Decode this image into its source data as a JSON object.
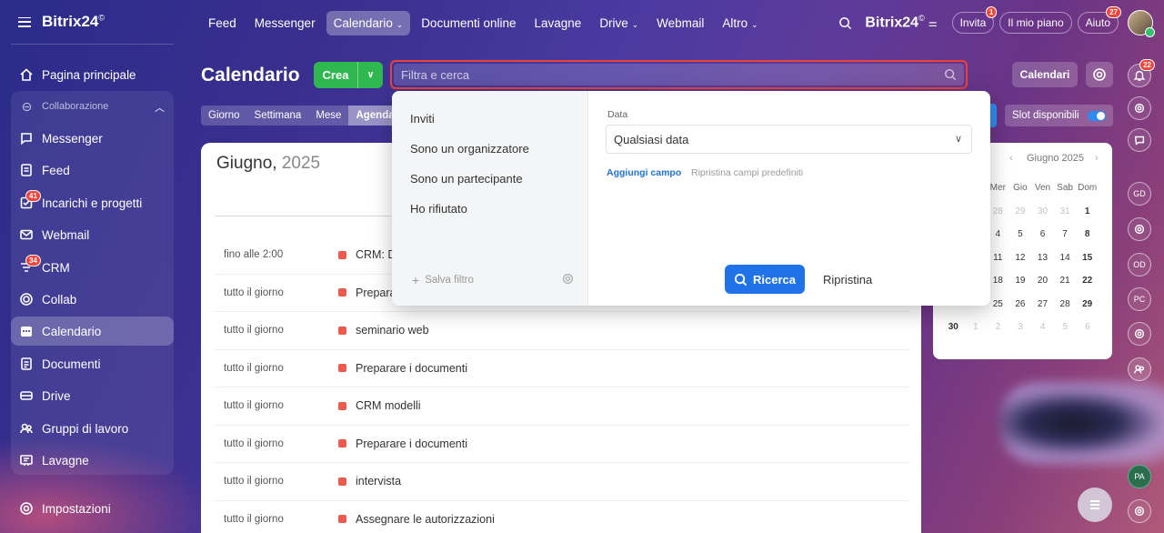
{
  "brand": {
    "name": "Bitrix24",
    "mark": "©"
  },
  "sidebar": {
    "group_label": "Collaborazione",
    "items": [
      {
        "label": "Pagina principale",
        "icon": "home-icon"
      },
      {
        "label": "Messenger",
        "icon": "chat-icon"
      },
      {
        "label": "Feed",
        "icon": "feed-icon"
      },
      {
        "label": "Incarichi e progetti",
        "icon": "tasks-icon",
        "badge": "41"
      },
      {
        "label": "Webmail",
        "icon": "mail-icon"
      },
      {
        "label": "CRM",
        "icon": "crm-icon",
        "badge": "34"
      },
      {
        "label": "Collab",
        "icon": "collab-icon"
      },
      {
        "label": "Calendario",
        "icon": "calendar-icon",
        "active": true
      },
      {
        "label": "Documenti",
        "icon": "document-icon"
      },
      {
        "label": "Drive",
        "icon": "drive-icon"
      },
      {
        "label": "Gruppi di lavoro",
        "icon": "groups-icon"
      },
      {
        "label": "Lavagne",
        "icon": "board-icon"
      }
    ],
    "settings_label": "Impostazioni"
  },
  "topnav": {
    "links": [
      "Feed",
      "Messenger",
      "Calendario",
      "Documenti online",
      "Lavagne",
      "Drive",
      "Webmail",
      "Altro"
    ],
    "invita": "Invita",
    "invita_badge": "1",
    "my_plan": "Il mio piano",
    "help": "Aiuto",
    "help_badge": "27"
  },
  "header": {
    "title": "Calendario",
    "create": "Crea",
    "search_placeholder": "Filtra e cerca",
    "calendars_button": "Calendari",
    "slot_label": "Slot disponibili"
  },
  "view_tabs": [
    "Giorno",
    "Settimana",
    "Mese",
    "Agenda"
  ],
  "agenda": {
    "month": "Giugno,",
    "year": "2025",
    "events": [
      {
        "time": "fino alle 2:00",
        "title": "CRM: D"
      },
      {
        "time": "tutto il giorno",
        "title": "Prepara"
      },
      {
        "time": "tutto il giorno",
        "title": "seminario web"
      },
      {
        "time": "tutto il giorno",
        "title": "Preparare i documenti"
      },
      {
        "time": "tutto il giorno",
        "title": "CRM modelli"
      },
      {
        "time": "tutto il giorno",
        "title": "Preparare i documenti"
      },
      {
        "time": "tutto il giorno",
        "title": "intervista"
      },
      {
        "time": "tutto il giorno",
        "title": "Assegnare le autorizzazioni"
      }
    ]
  },
  "mini_calendar": {
    "title": "Giugno 2025",
    "weekdays": [
      "Mer",
      "Gio",
      "Ven",
      "Sab",
      "Dom"
    ],
    "rows": [
      [
        {
          "d": "28",
          "dim": true
        },
        {
          "d": "29",
          "dim": true
        },
        {
          "d": "30",
          "dim": true
        },
        {
          "d": "31",
          "dim": true
        },
        {
          "d": "1"
        }
      ],
      [
        {
          "d": "4"
        },
        {
          "d": "5"
        },
        {
          "d": "6"
        },
        {
          "d": "7"
        },
        {
          "d": "8"
        }
      ],
      [
        {
          "d": "11"
        },
        {
          "d": "12"
        },
        {
          "d": "13"
        },
        {
          "d": "14"
        },
        {
          "d": "15"
        }
      ],
      [
        {
          "d": "18"
        },
        {
          "d": "19"
        },
        {
          "d": "20"
        },
        {
          "d": "21"
        },
        {
          "d": "22"
        }
      ],
      [
        {
          "d": "25"
        },
        {
          "d": "26"
        },
        {
          "d": "27"
        },
        {
          "d": "28"
        },
        {
          "d": "29"
        }
      ],
      [
        {
          "d": "30",
          "lead": true
        },
        {
          "d": "1",
          "dim": true
        },
        {
          "d": "2",
          "dim": true
        },
        {
          "d": "3",
          "dim": true
        },
        {
          "d": "4",
          "dim": true
        },
        {
          "d": "5",
          "dim": true
        },
        {
          "d": "6",
          "dim": true
        }
      ]
    ]
  },
  "filter_dropdown": {
    "presets": [
      "Inviti",
      "Sono un organizzatore",
      "Sono un partecipante",
      "Ho rifiutato"
    ],
    "save_filter": "Salva filtro",
    "date_label": "Data",
    "date_value": "Qualsiasi data",
    "add_field": "Aggiungi campo",
    "reset_fields": "Ripristina campi predefiniti",
    "search_button": "Ricerca",
    "reset_button": "Ripristina"
  },
  "right_rail": {
    "notifications_badge": "22",
    "avatars": [
      "GD",
      "OD",
      "PC",
      "PA"
    ]
  }
}
